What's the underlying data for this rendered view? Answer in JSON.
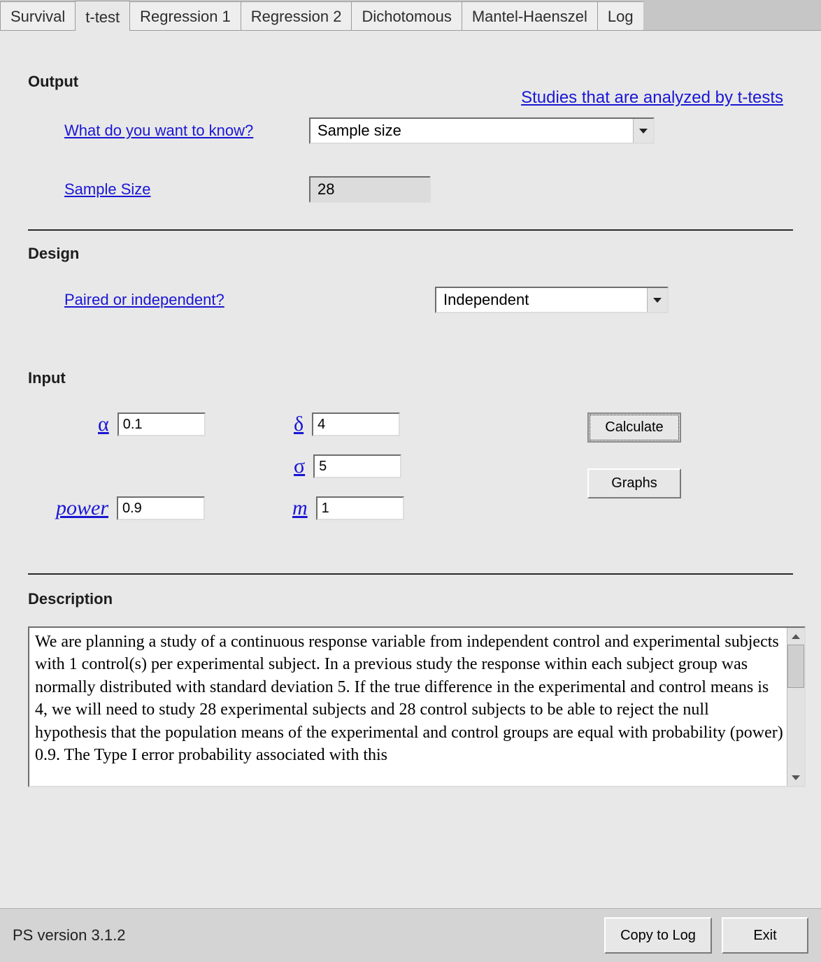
{
  "tabs": [
    {
      "label": "Survival"
    },
    {
      "label": "t-test"
    },
    {
      "label": "Regression 1"
    },
    {
      "label": "Regression 2"
    },
    {
      "label": "Dichotomous"
    },
    {
      "label": "Mantel-Haenszel"
    },
    {
      "label": "Log"
    }
  ],
  "active_tab": "t-test",
  "top_link": "Studies that are analyzed by t-tests",
  "sections": {
    "output": "Output",
    "design": "Design",
    "input": "Input",
    "description": "Description"
  },
  "output": {
    "want_label": "What do you want to know?",
    "want_value": "Sample size",
    "sample_size_label": "Sample Size",
    "sample_size_value": "28"
  },
  "design": {
    "paired_label": "Paired or independent?",
    "paired_value": "Independent"
  },
  "input": {
    "alpha_label": "α",
    "alpha_value": "0.1",
    "delta_label": "δ",
    "delta_value": "4",
    "sigma_label": "σ",
    "sigma_value": "5",
    "power_label": "power",
    "power_value": "0.9",
    "m_label": "m",
    "m_value": "1"
  },
  "buttons": {
    "calculate": "Calculate",
    "graphs": "Graphs",
    "copy_to_log": "Copy to Log",
    "exit": "Exit"
  },
  "description_text": "We are planning a study of a continuous response variable from independent control and experimental subjects with 1 control(s) per experimental subject.  In a previous study the response within each subject group was normally distributed with standard deviation 5.  If the true difference in the experimental and control means is 4, we will need to study 28 experimental subjects and 28 control subjects to be able to reject the null hypothesis that the population means of the experimental and control groups are equal with probability (power) 0.9.   The Type I error probability associated with this",
  "version": "PS version 3.1.2"
}
